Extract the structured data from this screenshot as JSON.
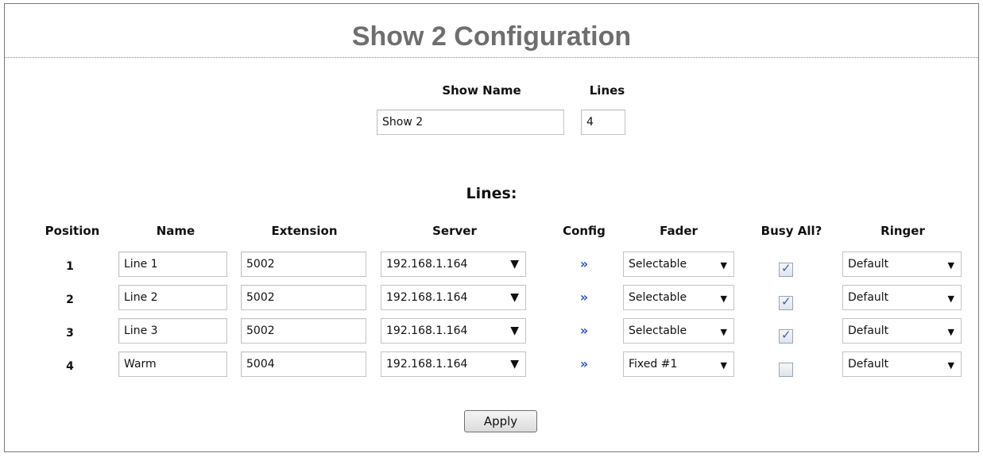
{
  "page": {
    "title": "Show 2 Configuration"
  },
  "show": {
    "name_label": "Show Name",
    "lines_label": "Lines",
    "name_value": "Show 2",
    "lines_value": "4"
  },
  "lines_section": {
    "title": "Lines:",
    "columns": [
      "Position",
      "Name",
      "Extension",
      "Server",
      "Config",
      "Fader",
      "Busy All?",
      "Ringer"
    ],
    "config_glyph": "»",
    "rows": [
      {
        "position": "1",
        "name": "Line 1",
        "extension": "5002",
        "server": "192.168.1.164",
        "fader": "Selectable",
        "busy_all": true,
        "ringer": "Default"
      },
      {
        "position": "2",
        "name": "Line 2",
        "extension": "5002",
        "server": "192.168.1.164",
        "fader": "Selectable",
        "busy_all": true,
        "ringer": "Default"
      },
      {
        "position": "3",
        "name": "Line 3",
        "extension": "5002",
        "server": "192.168.1.164",
        "fader": "Selectable",
        "busy_all": true,
        "ringer": "Default"
      },
      {
        "position": "4",
        "name": "Warm",
        "extension": "5004",
        "server": "192.168.1.164",
        "fader": "Fixed #1",
        "busy_all": false,
        "ringer": "Default"
      }
    ]
  },
  "actions": {
    "apply_label": "Apply"
  },
  "colors": {
    "title": "#6e6e6e",
    "config_link": "#2a4fd6",
    "checkmark": "#3b5fa8"
  }
}
